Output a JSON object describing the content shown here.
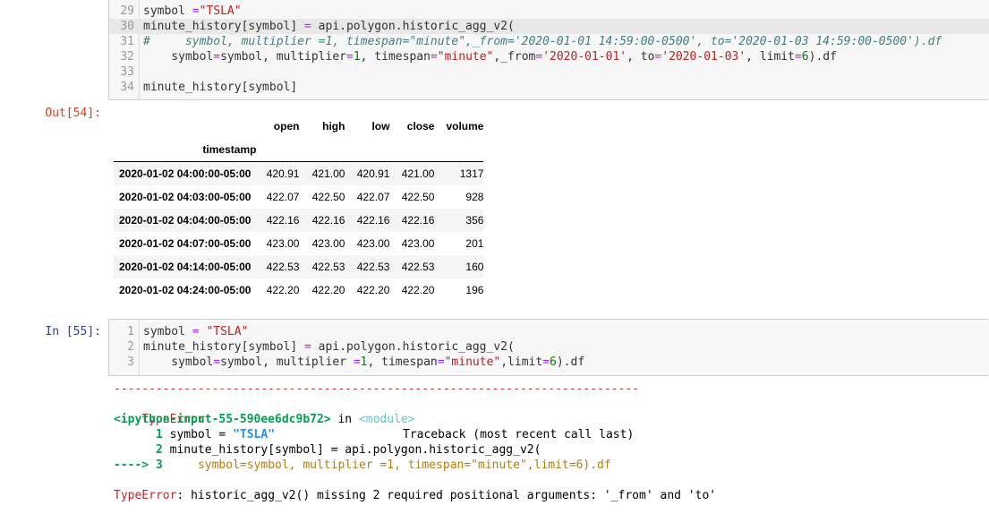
{
  "cell_prev": {
    "lines": [
      {
        "n": "29",
        "parts": [
          {
            "t": "symbol ",
            "c": ""
          },
          {
            "t": "=",
            "c": "op"
          },
          {
            "t": "\"TSLA\"",
            "c": "str"
          }
        ]
      },
      {
        "n": "30",
        "parts": [
          {
            "t": "minute_history[symbol] ",
            "c": ""
          },
          {
            "t": "=",
            "c": "op"
          },
          {
            "t": " api.polygon.historic_agg_v2(",
            "c": ""
          }
        ]
      },
      {
        "n": "31",
        "parts": [
          {
            "t": "#     symbol, multiplier =1, timespan=\"minute\",_from='2020-01-01 14:59:00-0500', to='2020-01-03 14:59:00-0500').df",
            "c": "cmt"
          }
        ]
      },
      {
        "n": "32",
        "parts": [
          {
            "t": "    symbol",
            "c": ""
          },
          {
            "t": "=",
            "c": "op"
          },
          {
            "t": "symbol, multiplier",
            "c": ""
          },
          {
            "t": "=",
            "c": "op"
          },
          {
            "t": "1",
            "c": "num"
          },
          {
            "t": ", timespan",
            "c": ""
          },
          {
            "t": "=",
            "c": "op"
          },
          {
            "t": "\"minute\"",
            "c": "str"
          },
          {
            "t": ",_from",
            "c": ""
          },
          {
            "t": "=",
            "c": "op"
          },
          {
            "t": "'2020-01-01'",
            "c": "str"
          },
          {
            "t": ", to",
            "c": ""
          },
          {
            "t": "=",
            "c": "op"
          },
          {
            "t": "'2020-01-03'",
            "c": "str"
          },
          {
            "t": ", limit",
            "c": ""
          },
          {
            "t": "=",
            "c": "op"
          },
          {
            "t": "6",
            "c": "num"
          },
          {
            "t": ").df",
            "c": ""
          }
        ]
      },
      {
        "n": "33",
        "parts": []
      },
      {
        "n": "34",
        "parts": [
          {
            "t": "minute_history[symbol]",
            "c": ""
          }
        ]
      }
    ]
  },
  "output": {
    "prompt": "Out[54]:",
    "columns": [
      "open",
      "high",
      "low",
      "close",
      "volume"
    ],
    "index_name": "timestamp",
    "rows": [
      [
        "2020-01-02 04:00:00-05:00",
        "420.91",
        "421.00",
        "420.91",
        "421.00",
        "1317"
      ],
      [
        "2020-01-02 04:03:00-05:00",
        "422.07",
        "422.50",
        "422.07",
        "422.50",
        "928"
      ],
      [
        "2020-01-02 04:04:00-05:00",
        "422.16",
        "422.16",
        "422.16",
        "422.16",
        "356"
      ],
      [
        "2020-01-02 04:07:00-05:00",
        "423.00",
        "423.00",
        "423.00",
        "423.00",
        "201"
      ],
      [
        "2020-01-02 04:14:00-05:00",
        "422.53",
        "422.53",
        "422.53",
        "422.53",
        "160"
      ],
      [
        "2020-01-02 04:24:00-05:00",
        "422.20",
        "422.20",
        "422.20",
        "422.20",
        "196"
      ]
    ]
  },
  "cell_in": {
    "prompt": "In [55]:",
    "lines": [
      {
        "n": "1",
        "parts": [
          {
            "t": "symbol ",
            "c": ""
          },
          {
            "t": "=",
            "c": "op"
          },
          {
            "t": " ",
            "c": ""
          },
          {
            "t": "\"TSLA\"",
            "c": "str"
          }
        ]
      },
      {
        "n": "2",
        "parts": [
          {
            "t": "minute_history[symbol] ",
            "c": ""
          },
          {
            "t": "=",
            "c": "op"
          },
          {
            "t": " api.polygon.historic_agg_v2(",
            "c": ""
          }
        ]
      },
      {
        "n": "3",
        "parts": [
          {
            "t": "    symbol",
            "c": ""
          },
          {
            "t": "=",
            "c": "op"
          },
          {
            "t": "symbol, multiplier ",
            "c": ""
          },
          {
            "t": "=",
            "c": "op"
          },
          {
            "t": "1",
            "c": "num"
          },
          {
            "t": ", timespan",
            "c": ""
          },
          {
            "t": "=",
            "c": "op"
          },
          {
            "t": "\"minute\"",
            "c": "str"
          },
          {
            "t": ",limit",
            "c": ""
          },
          {
            "t": "=",
            "c": "op"
          },
          {
            "t": "6",
            "c": "num"
          },
          {
            "t": ").df",
            "c": ""
          }
        ]
      }
    ]
  },
  "traceback": {
    "separator": "---------------------------------------------------------------------------",
    "error_type": "TypeError",
    "header_right": "Traceback (most recent call last)",
    "input_ref": "<ipython-input-55-590ee6dc9b72>",
    "in_word": " in ",
    "module": "<module>",
    "l1_num": "      1 ",
    "l1_code_a": "symbol ",
    "l1_code_eq": "=",
    "l1_code_str": " \"TSLA\"",
    "l2_num": "      2 ",
    "l2_code": "minute_history[symbol] = api.polygon.historic_agg_v2(",
    "arrow": "----> 3 ",
    "l3_code": "    symbol=symbol, multiplier =1, timespan=\"minute\",limit=6).df",
    "final_type": "TypeError",
    "final_msg": ": historic_agg_v2() missing 2 required positional arguments: '_from' and 'to'"
  }
}
